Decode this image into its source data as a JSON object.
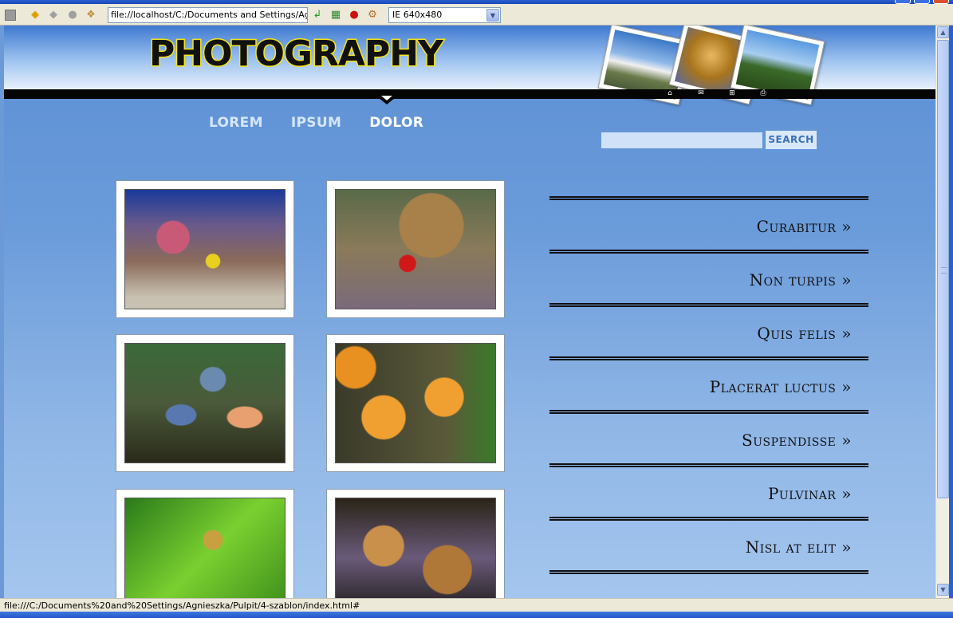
{
  "browser": {
    "url": "file://localhost/C:/Documents and Settings/Agniesz",
    "size_option": "IE 640x480",
    "status_text": "file:///C:/Documents%20and%20Settings/Agnieszka/Pulpit/4-szablon/index.html#"
  },
  "site": {
    "logo": "PHOTOGRAPHY",
    "nav": [
      {
        "label": "LOREM"
      },
      {
        "label": "IPSUM"
      },
      {
        "label": "DOLOR"
      }
    ],
    "search_button": "SEARCH",
    "side_links": [
      {
        "label": "Curabitur »"
      },
      {
        "label": "Non turpis »"
      },
      {
        "label": "Quis felis »"
      },
      {
        "label": "Placerat luctus »"
      },
      {
        "label": "Suspendisse »"
      },
      {
        "label": "Pulvinar »"
      },
      {
        "label": "Nisl at elit »"
      }
    ]
  },
  "icons": [
    "back-icon",
    "forward-icon",
    "stop-icon",
    "refresh-icon",
    "home-icon",
    "mail-icon",
    "sitemap-icon",
    "print-icon"
  ],
  "colors": {
    "logo_fill": "#111111",
    "logo_outline": "#f7e417",
    "accent_blue": "#5b8fd4"
  }
}
